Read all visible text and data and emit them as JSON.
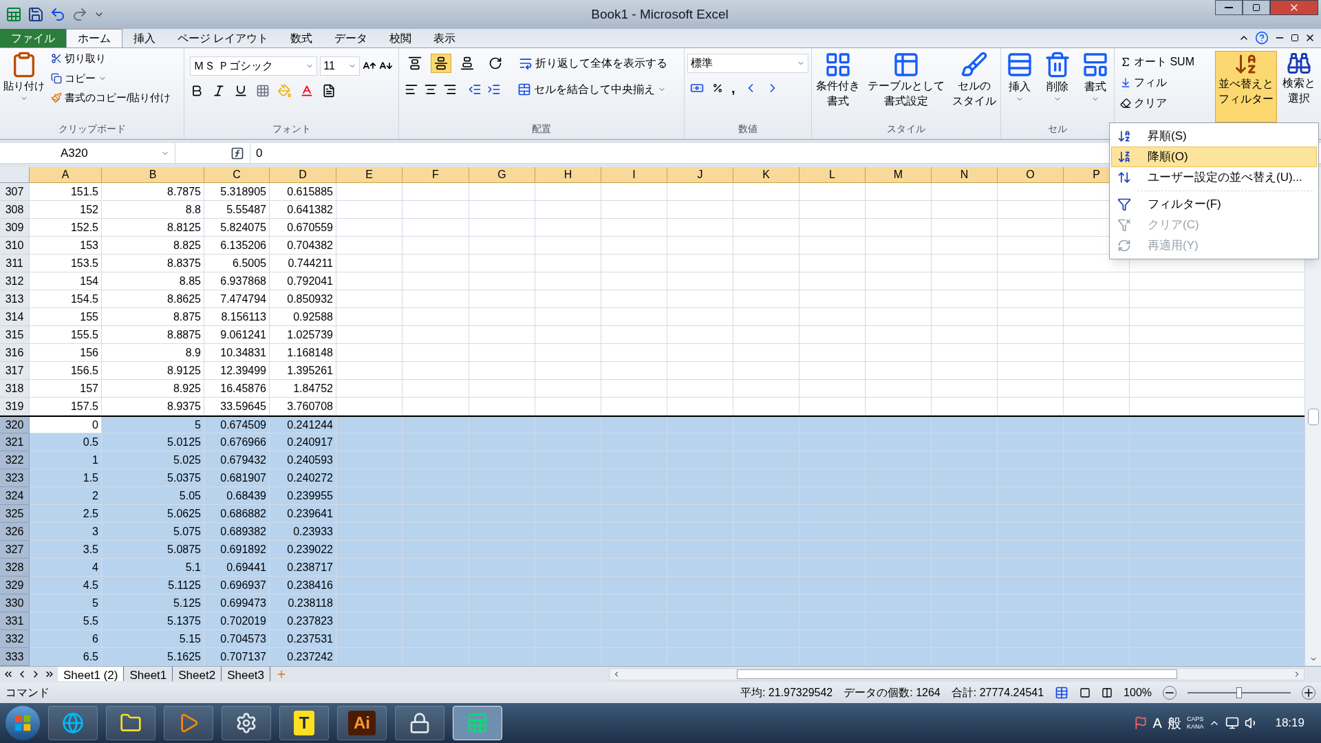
{
  "window": {
    "title": "Book1 - Microsoft Excel"
  },
  "ribbon_tabs": [
    {
      "label": "ファイル",
      "kind": "file",
      "selected": false
    },
    {
      "label": "ホーム",
      "kind": "tab",
      "selected": true
    },
    {
      "label": "挿入",
      "kind": "tab",
      "selected": false
    },
    {
      "label": "ページ レイアウト",
      "kind": "tab",
      "selected": false
    },
    {
      "label": "数式",
      "kind": "tab",
      "selected": false
    },
    {
      "label": "データ",
      "kind": "tab",
      "selected": false
    },
    {
      "label": "校閲",
      "kind": "tab",
      "selected": false
    },
    {
      "label": "表示",
      "kind": "tab",
      "selected": false
    }
  ],
  "clipboard": {
    "label": "クリップボード",
    "paste": "貼り付け",
    "cut": "切り取り",
    "copy": "コピー",
    "format_painter": "書式のコピー/貼り付け"
  },
  "font": {
    "label": "フォント",
    "name": "ＭＳ Ｐゴシック",
    "size": "11"
  },
  "alignment": {
    "label": "配置",
    "vertical": [
      {
        "selected": false
      },
      {
        "selected": true
      },
      {
        "selected": false
      }
    ],
    "wrap": "折り返して全体を表示する",
    "merge": "セルを結合して中央揃え"
  },
  "number": {
    "label": "数値",
    "format": "標準",
    "comma": ","
  },
  "styles": {
    "label": "スタイル",
    "buttons": [
      {
        "lines": [
          "条件付き",
          "書式"
        ]
      },
      {
        "lines": [
          "テーブルとして",
          "書式設定"
        ]
      },
      {
        "lines": [
          "セルの",
          "スタイル"
        ]
      }
    ]
  },
  "cells": {
    "label": "セル",
    "buttons": [
      "挿入",
      "削除",
      "書式"
    ]
  },
  "editing": {
    "autosum": "オート SUM",
    "fill": "フィル",
    "clear": "クリア",
    "sort": {
      "lines": [
        "並べ替えと",
        "フィルター"
      ],
      "open": true
    },
    "find": {
      "lines": [
        "検索と",
        "選択"
      ]
    }
  },
  "name_box": "A320",
  "formula": "0",
  "columns": [
    "A",
    "B",
    "C",
    "D",
    "E",
    "F",
    "G",
    "H",
    "I",
    "J",
    "K",
    "L",
    "M",
    "N",
    "O",
    "P"
  ],
  "rows": [
    {
      "n": "307",
      "cells": [
        "151.5",
        "8.7875",
        "5.318905",
        "0.615885"
      ],
      "selected": false,
      "active": false
    },
    {
      "n": "308",
      "cells": [
        "152",
        "8.8",
        "5.55487",
        "0.641382"
      ],
      "selected": false,
      "active": false
    },
    {
      "n": "309",
      "cells": [
        "152.5",
        "8.8125",
        "5.824075",
        "0.670559"
      ],
      "selected": false,
      "active": false
    },
    {
      "n": "310",
      "cells": [
        "153",
        "8.825",
        "6.135206",
        "0.704382"
      ],
      "selected": false,
      "active": false
    },
    {
      "n": "311",
      "cells": [
        "153.5",
        "8.8375",
        "6.5005",
        "0.744211"
      ],
      "selected": false,
      "active": false
    },
    {
      "n": "312",
      "cells": [
        "154",
        "8.85",
        "6.937868",
        "0.792041"
      ],
      "selected": false,
      "active": false
    },
    {
      "n": "313",
      "cells": [
        "154.5",
        "8.8625",
        "7.474794",
        "0.850932"
      ],
      "selected": false,
      "active": false
    },
    {
      "n": "314",
      "cells": [
        "155",
        "8.875",
        "8.156113",
        "0.92588"
      ],
      "selected": false,
      "active": false
    },
    {
      "n": "315",
      "cells": [
        "155.5",
        "8.8875",
        "9.061241",
        "1.025739"
      ],
      "selected": false,
      "active": false
    },
    {
      "n": "316",
      "cells": [
        "156",
        "8.9",
        "10.34831",
        "1.168148"
      ],
      "selected": false,
      "active": false
    },
    {
      "n": "317",
      "cells": [
        "156.5",
        "8.9125",
        "12.39499",
        "1.395261"
      ],
      "selected": false,
      "active": false
    },
    {
      "n": "318",
      "cells": [
        "157",
        "8.925",
        "16.45876",
        "1.84752"
      ],
      "selected": false,
      "active": false
    },
    {
      "n": "319",
      "cells": [
        "157.5",
        "8.9375",
        "33.59645",
        "3.760708"
      ],
      "selected": false,
      "active": false
    },
    {
      "n": "320",
      "cells": [
        "0",
        "5",
        "0.674509",
        "0.241244"
      ],
      "selected": true,
      "active": true
    },
    {
      "n": "321",
      "cells": [
        "0.5",
        "5.0125",
        "0.676966",
        "0.240917"
      ],
      "selected": true,
      "active": false
    },
    {
      "n": "322",
      "cells": [
        "1",
        "5.025",
        "0.679432",
        "0.240593"
      ],
      "selected": true,
      "active": false
    },
    {
      "n": "323",
      "cells": [
        "1.5",
        "5.0375",
        "0.681907",
        "0.240272"
      ],
      "selected": true,
      "active": false
    },
    {
      "n": "324",
      "cells": [
        "2",
        "5.05",
        "0.68439",
        "0.239955"
      ],
      "selected": true,
      "active": false
    },
    {
      "n": "325",
      "cells": [
        "2.5",
        "5.0625",
        "0.686882",
        "0.239641"
      ],
      "selected": true,
      "active": false
    },
    {
      "n": "326",
      "cells": [
        "3",
        "5.075",
        "0.689382",
        "0.23933"
      ],
      "selected": true,
      "active": false
    },
    {
      "n": "327",
      "cells": [
        "3.5",
        "5.0875",
        "0.691892",
        "0.239022"
      ],
      "selected": true,
      "active": false
    },
    {
      "n": "328",
      "cells": [
        "4",
        "5.1",
        "0.69441",
        "0.238717"
      ],
      "selected": true,
      "active": false
    },
    {
      "n": "329",
      "cells": [
        "4.5",
        "5.1125",
        "0.696937",
        "0.238416"
      ],
      "selected": true,
      "active": false
    },
    {
      "n": "330",
      "cells": [
        "5",
        "5.125",
        "0.699473",
        "0.238118"
      ],
      "selected": true,
      "active": false
    },
    {
      "n": "331",
      "cells": [
        "5.5",
        "5.1375",
        "0.702019",
        "0.237823"
      ],
      "selected": true,
      "active": false
    },
    {
      "n": "332",
      "cells": [
        "6",
        "5.15",
        "0.704573",
        "0.237531"
      ],
      "selected": true,
      "active": false
    },
    {
      "n": "333",
      "cells": [
        "6.5",
        "5.1625",
        "0.707137",
        "0.237242"
      ],
      "selected": true,
      "active": false
    }
  ],
  "sort_menu": [
    {
      "label": "昇順(S)",
      "kind": "asc",
      "selected": false,
      "disabled": false
    },
    {
      "label": "降順(O)",
      "kind": "desc",
      "selected": true,
      "disabled": false
    },
    {
      "label": "ユーザー設定の並べ替え(U)...",
      "kind": "custom",
      "selected": false,
      "disabled": false
    },
    {
      "label": "フィルター(F)",
      "kind": "filter",
      "selected": false,
      "disabled": false
    },
    {
      "label": "クリア(C)",
      "kind": "clear",
      "selected": false,
      "disabled": true
    },
    {
      "label": "再適用(Y)",
      "kind": "reapply",
      "selected": false,
      "disabled": true
    }
  ],
  "sheet_tabs": [
    {
      "label": "Sheet1 (2)",
      "selected": true
    },
    {
      "label": "Sheet1",
      "selected": false
    },
    {
      "label": "Sheet2",
      "selected": false
    },
    {
      "label": "Sheet3",
      "selected": false
    }
  ],
  "status_bar": {
    "mode": "コマンド",
    "average": "平均: 21.97329542",
    "count": "データの個数: 1264",
    "sum": "合計: 27774.24541",
    "zoom": "100%",
    "zoom_slider": {
      "level": 0.5
    }
  },
  "taskbar": {
    "apps": [
      {
        "kind": "ie",
        "active": false
      },
      {
        "kind": "folder",
        "active": false
      },
      {
        "kind": "media",
        "active": false
      },
      {
        "kind": "settings",
        "active": false
      },
      {
        "kind": "t",
        "text": "T",
        "active": false
      },
      {
        "kind": "ai",
        "text": "Ai",
        "active": false
      },
      {
        "kind": "lock",
        "active": false
      },
      {
        "kind": "excel",
        "active": true
      }
    ],
    "ime": [
      "A",
      "般"
    ],
    "caps": "CAPS",
    "kana": "KANA",
    "time": "18:19"
  }
}
